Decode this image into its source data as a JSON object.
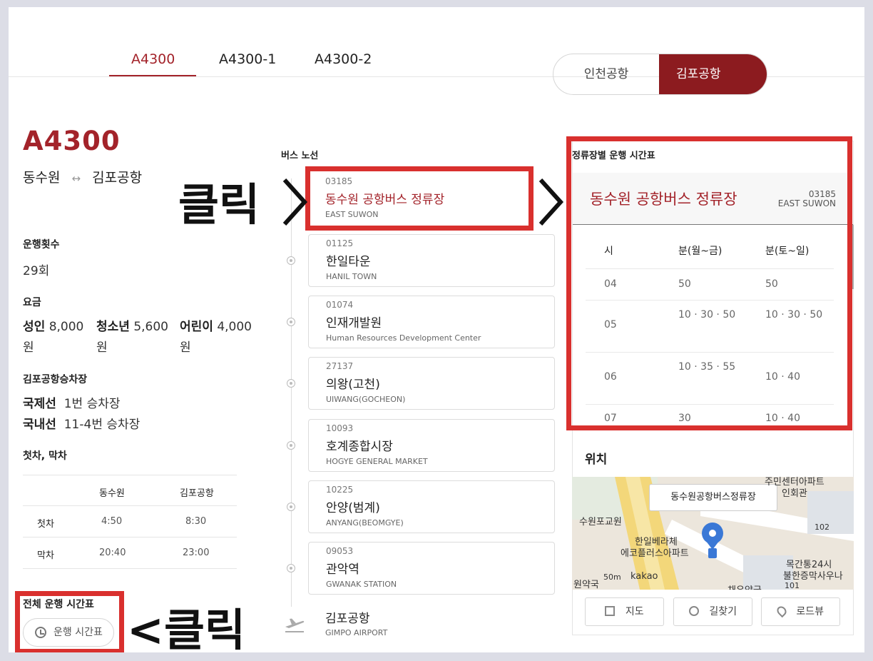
{
  "tabs": [
    "A4300",
    "A4300-1",
    "A4300-2"
  ],
  "airport_toggle": {
    "incheon": "인천공항",
    "gimpo": "김포공항"
  },
  "route": {
    "title": "A4300",
    "from": "동수원",
    "arrow": "↔",
    "to": "김포공항",
    "trips_label": "운행횟수",
    "trips_value": "29회",
    "fare_label": "요금",
    "fares": [
      {
        "label": "성인",
        "value": "8,000",
        "unit": "원"
      },
      {
        "label": "청소년",
        "value": "5,600",
        "unit": "원"
      },
      {
        "label": "어린이",
        "value": "4,000",
        "unit": "원"
      }
    ],
    "boarding_label": "김포공항승차장",
    "boarding": [
      {
        "label": "국제선",
        "value": "1번 승차장"
      },
      {
        "label": "국내선",
        "value": "11-4번 승차장"
      }
    ],
    "first_last_label": "첫차, 막차",
    "first_last": {
      "columns": [
        "동수원",
        "김포공항"
      ],
      "rows": [
        {
          "label": "첫차",
          "values": [
            "4:50",
            "8:30"
          ]
        },
        {
          "label": "막차",
          "values": [
            "20:40",
            "23:00"
          ]
        }
      ]
    },
    "full_timetable_label": "전체 운행 시간표",
    "timetable_button": "운행 시간표"
  },
  "annotations": {
    "click_right": "클릭",
    "click_left": "<클릭"
  },
  "stops_label": "버스 노선",
  "stops": [
    {
      "code": "03185",
      "name": "동수원 공항버스 정류장",
      "en": "EAST SUWON"
    },
    {
      "code": "01125",
      "name": "한일타운",
      "en": "HANIL TOWN"
    },
    {
      "code": "01074",
      "name": "인재개발원",
      "en": "Human Resources Development Center"
    },
    {
      "code": "27137",
      "name": "의왕(고천)",
      "en": "UIWANG(GOCHEON)"
    },
    {
      "code": "10093",
      "name": "호계종합시장",
      "en": "HOGYE GENERAL MARKET"
    },
    {
      "code": "10225",
      "name": "안양(범계)",
      "en": "ANYANG(BEOMGYE)"
    },
    {
      "code": "09053",
      "name": "관악역",
      "en": "GWANAK STATION"
    }
  ],
  "terminal": {
    "name": "김포공항",
    "en": "GIMPO AIRPORT"
  },
  "timetable": {
    "title": "정류장별 운행 시간표",
    "stop_name": "동수원 공항버스 정류장",
    "stop_code": "03185",
    "stop_en": "EAST SUWON",
    "headers": [
      "시",
      "분(월~금)",
      "분(토~일)"
    ],
    "rows": [
      {
        "hour": "04",
        "weekday": "50",
        "weekend": "50"
      },
      {
        "hour": "05",
        "weekday": "10 · 30 · 50",
        "weekend": "10 · 30 · 50"
      },
      {
        "hour": "06",
        "weekday": "10 · 35 · 55",
        "weekend": "10 · 40"
      },
      {
        "hour": "07",
        "weekday": "30",
        "weekend": "10 · 40"
      }
    ]
  },
  "location": {
    "title": "위치",
    "callout": "동수원공항버스정류장",
    "labels": {
      "suwon_post": "수원포교원",
      "hanil_verachae": "한일베라체",
      "eco_apt": "에코플러스아파트",
      "mokgan": "목간통24시",
      "pharmacy": "불한증막사우나",
      "hall": "인회관",
      "apt_top": "주민센터아파트",
      "scale": "50m",
      "brand": "kakao",
      "num_102": "102",
      "num_101": "101",
      "jeon": "원약국",
      "bottom": "채우약국"
    },
    "buttons": [
      "지도",
      "길찾기",
      "로드뷰"
    ]
  },
  "colors": {
    "accent": "#a3232a",
    "accent_dark": "#8c1b1f",
    "annotation_red": "#d9302e"
  }
}
